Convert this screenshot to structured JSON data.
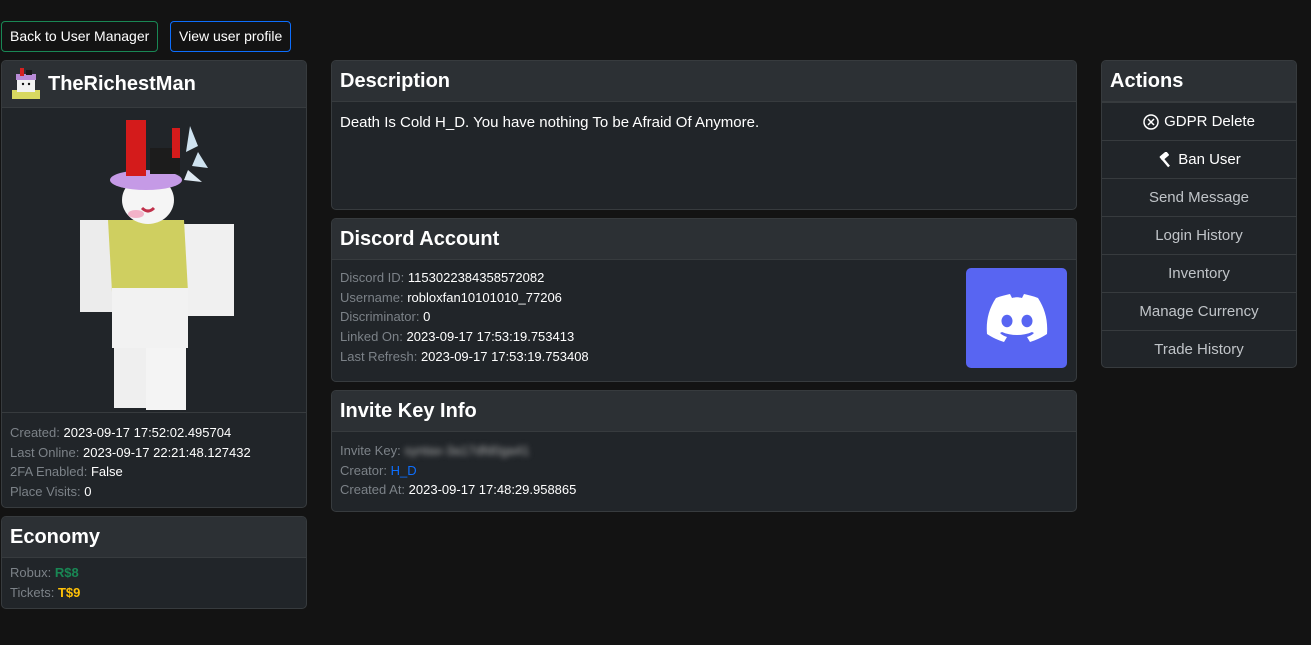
{
  "top_buttons": {
    "back": "Back to User Manager",
    "view_profile": "View user profile"
  },
  "profile": {
    "username": "TheRichestMan",
    "created_label": "Created:",
    "created_value": "2023-09-17 17:52:02.495704",
    "last_online_label": "Last Online:",
    "last_online_value": "2023-09-17 22:21:48.127432",
    "twofa_label": "2FA Enabled:",
    "twofa_value": "False",
    "visits_label": "Place Visits:",
    "visits_value": "0"
  },
  "economy": {
    "title": "Economy",
    "robux_label": "Robux:",
    "robux_value": "R$8",
    "tickets_label": "Tickets:",
    "tickets_value": "T$9"
  },
  "description": {
    "title": "Description",
    "text": "Death Is Cold H_D. You have nothing To be Afraid Of Anymore."
  },
  "discord": {
    "title": "Discord Account",
    "id_label": "Discord ID:",
    "id_value": "1153022384358572082",
    "username_label": "Username:",
    "username_value": "robloxfan10101010_77206",
    "disc_label": "Discriminator:",
    "disc_value": "0",
    "linked_label": "Linked On:",
    "linked_value": "2023-09-17 17:53:19.753413",
    "refresh_label": "Last Refresh:",
    "refresh_value": "2023-09-17 17:53:19.753408"
  },
  "invite": {
    "title": "Invite Key Info",
    "key_label": "Invite Key:",
    "key_value": "syntax-3a17dfd0ga41",
    "creator_label": "Creator:",
    "creator_value": "H_D",
    "created_label": "Created At:",
    "created_value": "2023-09-17 17:48:29.958865"
  },
  "actions": {
    "title": "Actions",
    "items": [
      {
        "label": "GDPR Delete",
        "icon": "x-circle-icon"
      },
      {
        "label": "Ban User",
        "icon": "hammer-icon"
      },
      {
        "label": "Send Message"
      },
      {
        "label": "Login History"
      },
      {
        "label": "Inventory"
      },
      {
        "label": "Manage Currency"
      },
      {
        "label": "Trade History"
      }
    ]
  },
  "colors": {
    "background": "#131313",
    "card": "#212529",
    "robux": "#198754",
    "tickets": "#ffc107",
    "discord": "#5865f2",
    "link": "#0d6efd"
  }
}
